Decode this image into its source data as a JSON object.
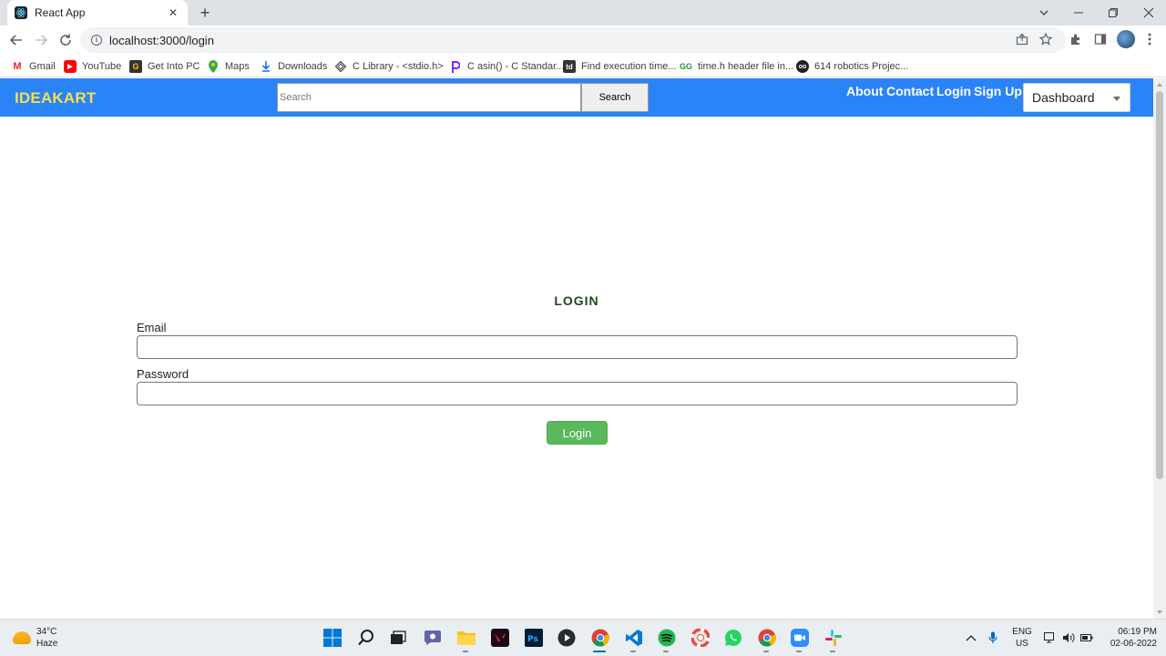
{
  "browser": {
    "tab_title": "React App",
    "url": "localhost:3000/login",
    "bookmarks": [
      {
        "label": "Gmail",
        "icon": "gmail-icon"
      },
      {
        "label": "YouTube",
        "icon": "youtube-icon"
      },
      {
        "label": "Get Into PC",
        "icon": "getintopc-icon"
      },
      {
        "label": "Maps",
        "icon": "maps-icon"
      },
      {
        "label": "Downloads",
        "icon": "download-icon"
      },
      {
        "label": "C Library - <stdio.h>",
        "icon": "c-library-icon"
      },
      {
        "label": "C asin() - C Standar...",
        "icon": "programiz-icon"
      },
      {
        "label": "Find execution time...",
        "icon": "td-icon"
      },
      {
        "label": "time.h header file in...",
        "icon": "gfg-icon"
      },
      {
        "label": "614 robotics Projec...",
        "icon": "robotics-icon"
      }
    ]
  },
  "site": {
    "brand": "IDEAKART",
    "search_placeholder": "Search",
    "search_button": "Search",
    "nav_links": [
      "About",
      "Contact",
      "Login",
      "Sign Up"
    ],
    "dropdown_value": "Dashboard",
    "colors": {
      "navbar": "#2a83f7",
      "brand": "#f4e04d",
      "login_button": "#5cb85c"
    }
  },
  "login": {
    "title": "LOGIN",
    "email_label": "Email",
    "email_value": "",
    "password_label": "Password",
    "password_value": "",
    "submit_label": "Login"
  },
  "taskbar": {
    "weather_temp": "34°C",
    "weather_desc": "Haze",
    "language_1": "ENG",
    "language_2": "US",
    "time": "06:19 PM",
    "date": "02-06-2022"
  }
}
